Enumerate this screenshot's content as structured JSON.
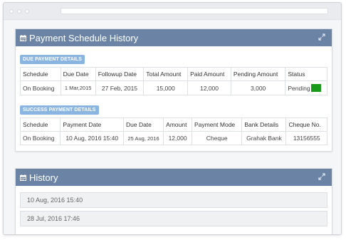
{
  "schedule_panel": {
    "title": "Payment Schedule History",
    "icon": "calendar-icon",
    "expand_icon": "expand-icon",
    "due": {
      "label": "DUE PAYMENT DETAILS",
      "headers": [
        "Schedule",
        "Due Date",
        "Followup Date",
        "Total Amount",
        "Paid Amount",
        "Pending Amount",
        "Status"
      ],
      "rows": [
        {
          "schedule": "On Booking",
          "due_date": "1 Mar,2015",
          "followup_date": "27 Feb, 2015",
          "total": "15,000",
          "paid": "12,000",
          "pending": "3,000",
          "status": "Pending",
          "status_color": "#1a9a1a"
        }
      ]
    },
    "success": {
      "label": "SUCCESS PAYMENT DETAILS",
      "headers": [
        "Schedule",
        "Payment Date",
        "Due Date",
        "Amount",
        "Payment Mode",
        "Bank Details",
        "Cheque No."
      ],
      "rows": [
        {
          "schedule": "On Booking",
          "payment_date": "10 Aug, 2016 15:40",
          "due_date": "25 Aug, 2016",
          "amount": "12,000",
          "mode": "Cheque",
          "bank": "Grahak Bank",
          "cheque": "13156555"
        }
      ]
    }
  },
  "history_panel": {
    "title": "History",
    "icon": "calendar-icon",
    "expand_icon": "expand-icon",
    "items": [
      "10 Aug, 2016 15:40",
      "28 Jul, 2016 17:46"
    ]
  },
  "colors": {
    "panel_header": "#6b84a6",
    "section_label": "#8ab5e0",
    "status_green": "#1a9a1a"
  }
}
